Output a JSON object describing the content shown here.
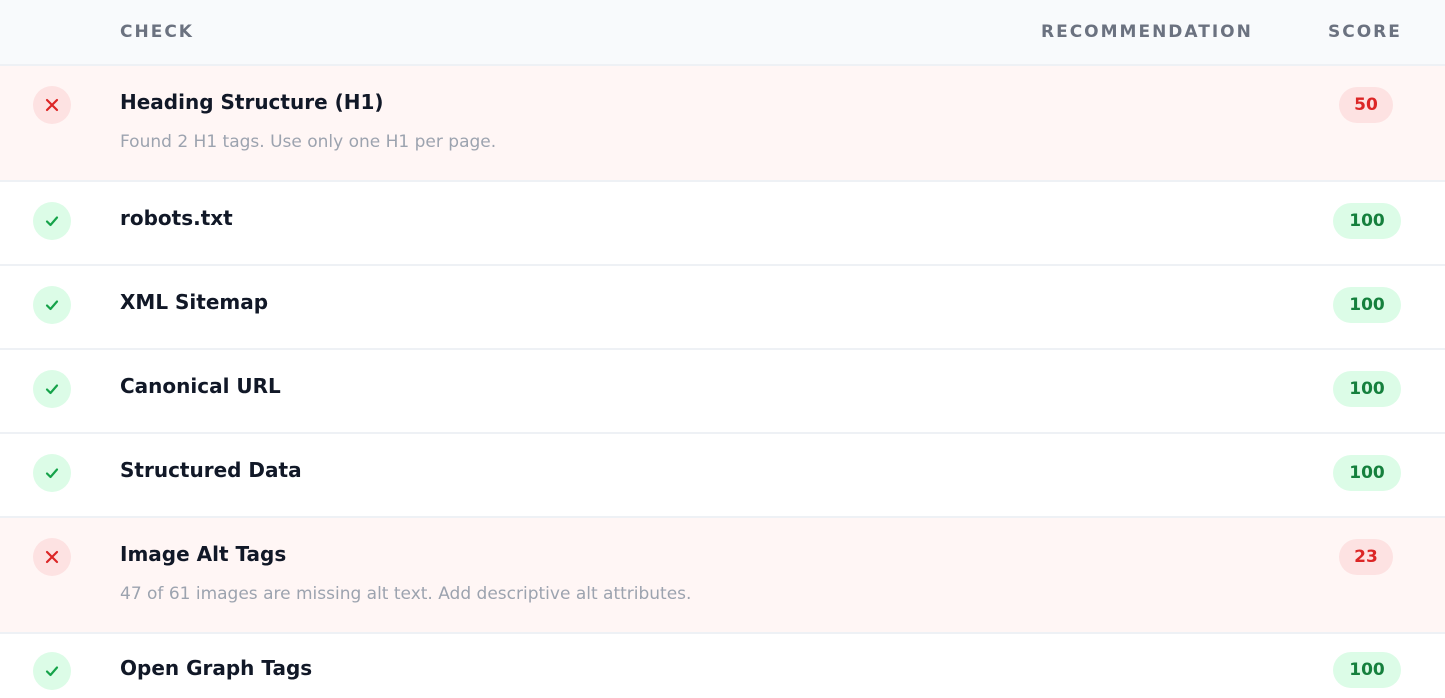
{
  "header": {
    "check": "CHECK",
    "recommendation": "RECOMMENDATION",
    "score": "SCORE"
  },
  "colors": {
    "fail_accent": "#dc2626",
    "fail_bg": "#fde2e2",
    "pass_accent": "#16a34a",
    "pass_bg": "#dcfce7"
  },
  "rows": [
    {
      "status": "fail",
      "icon": "x-icon",
      "title": "Heading Structure (H1)",
      "desc": "Found 2 H1 tags. Use only one H1 per page.",
      "score": "50"
    },
    {
      "status": "pass",
      "icon": "check-icon",
      "title": "robots.txt",
      "desc": "",
      "score": "100"
    },
    {
      "status": "pass",
      "icon": "check-icon",
      "title": "XML Sitemap",
      "desc": "",
      "score": "100"
    },
    {
      "status": "pass",
      "icon": "check-icon",
      "title": "Canonical URL",
      "desc": "",
      "score": "100"
    },
    {
      "status": "pass",
      "icon": "check-icon",
      "title": "Structured Data",
      "desc": "",
      "score": "100"
    },
    {
      "status": "fail",
      "icon": "x-icon",
      "title": "Image Alt Tags",
      "desc": "47 of 61 images are missing alt text. Add descriptive alt attributes.",
      "score": "23"
    },
    {
      "status": "pass",
      "icon": "check-icon",
      "title": "Open Graph Tags",
      "desc": "",
      "score": "100"
    }
  ]
}
